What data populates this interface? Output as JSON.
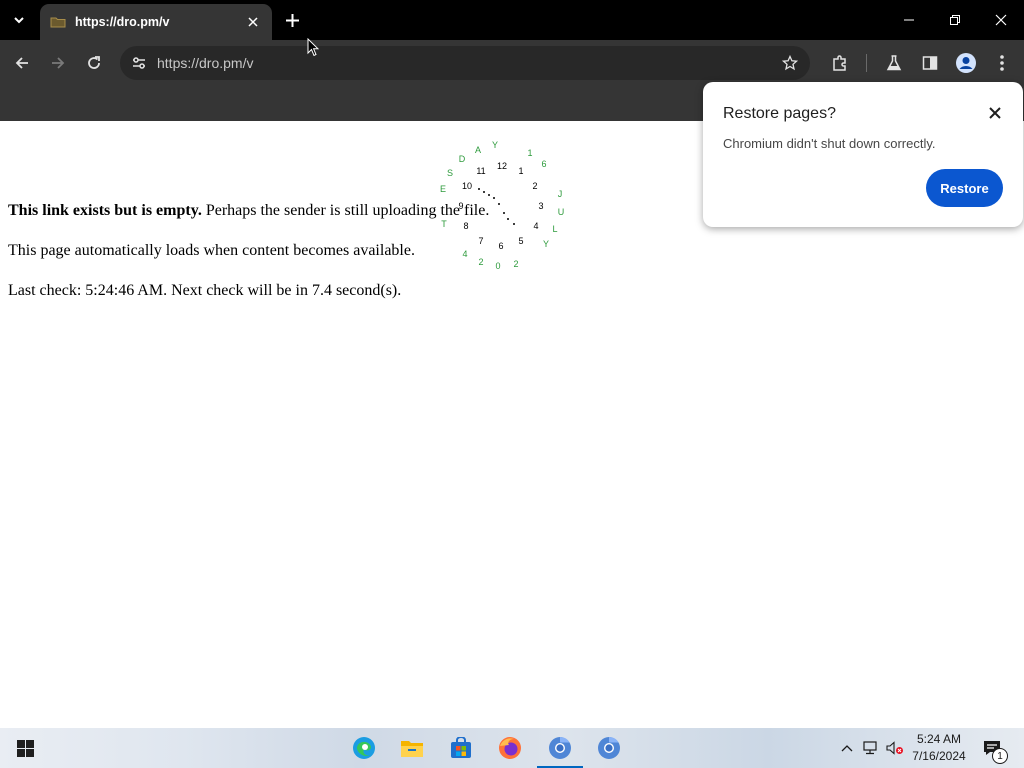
{
  "browser": {
    "tab_title": "https://dro.pm/v",
    "url": "https://dro.pm/v"
  },
  "page": {
    "line1_bold": "This link exists but is empty.",
    "line1_rest": " Perhaps the sender is still uploading the file.",
    "line2": "This page automatically loads when content becomes available.",
    "line3_prefix": "Last check: ",
    "last_check_time": "5:24:46 AM",
    "line3_mid": ". Next check will be in ",
    "next_check_seconds": "7.4",
    "line3_suffix": " second(s)."
  },
  "clock_widget": {
    "hour_numbers": [
      "12",
      "1",
      "2",
      "3",
      "4",
      "5",
      "6",
      "7",
      "8",
      "9",
      "10",
      "11"
    ],
    "date_ring": [
      "Y",
      "1",
      "6",
      "J",
      "U",
      "L",
      "Y",
      "2",
      "0",
      "2",
      "4",
      "T",
      "E",
      "S",
      "D",
      "A"
    ]
  },
  "restore_bubble": {
    "title": "Restore pages?",
    "message": "Chromium didn't shut down correctly.",
    "button": "Restore"
  },
  "taskbar": {
    "time": "5:24 AM",
    "date": "7/16/2024",
    "notification_count": "1"
  },
  "colors": {
    "accent": "#0b57d0",
    "chrome_dark": "#353535",
    "date_ring": "#2c9a3b"
  }
}
